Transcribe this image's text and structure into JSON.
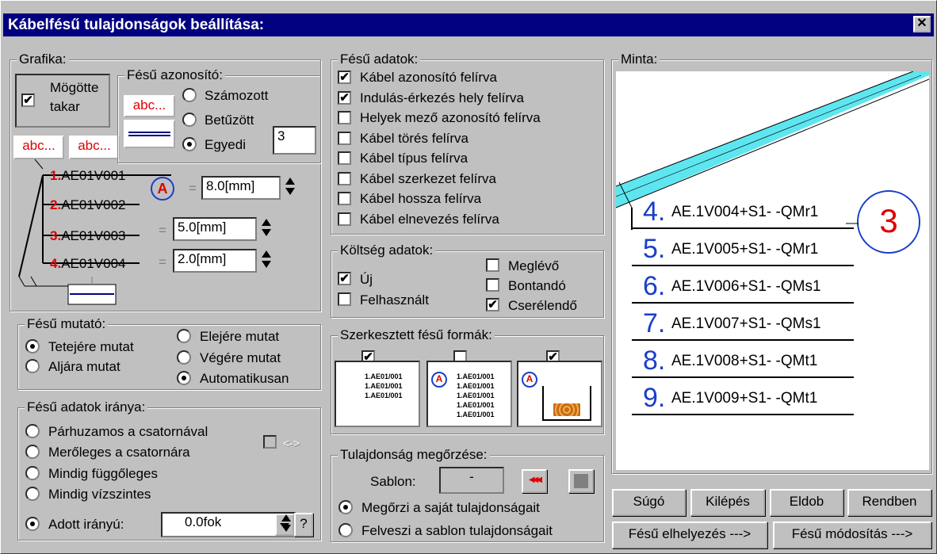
{
  "window": {
    "title": "Kábelfésű tulajdonságok beállítása:",
    "close": "✕"
  },
  "grafika": {
    "legend": "Grafika:",
    "behind_label1": "Mögötte",
    "behind_label2": "takar",
    "behind_checked": true,
    "abc1": "abc...",
    "abc2": "abc...",
    "rows": [
      {
        "num": "1.",
        "code": "AE01V001"
      },
      {
        "num": "2.",
        "code": "AE01V002"
      },
      {
        "num": "3.",
        "code": "AE01V003"
      },
      {
        "num": "4.",
        "code": "AE01V004"
      }
    ],
    "a_label": "A",
    "eq": "=",
    "dim1": "8.0[mm]",
    "dim2": "5.0[mm]",
    "dim3": "2.0[mm]"
  },
  "azonosito": {
    "legend": "Fésű azonosító:",
    "abc": "abc...",
    "opts": [
      "Számozott",
      "Betűzött",
      "Egyedi"
    ],
    "selected": 2,
    "value": "3"
  },
  "mutato": {
    "legend": "Fésű mutató:",
    "left": [
      "Tetejére mutat",
      "Aljára mutat"
    ],
    "right": [
      "Elejére mutat",
      "Végére mutat",
      "Automatikusan"
    ],
    "sel_left": 0,
    "sel_right": 2
  },
  "irany": {
    "legend": "Fésű adatok iránya:",
    "opts": [
      "Párhuzamos a csatornával",
      "Merőleges a csatornára",
      "Mindig függőleges",
      "Mindig vízszintes",
      "Adott irányú:"
    ],
    "selected": 4,
    "swap": "<->",
    "angle": "0.0fok",
    "help": "?"
  },
  "adatok": {
    "legend": "Fésű adatok:",
    "items": [
      {
        "label": "Kábel azonosító felírva",
        "checked": true
      },
      {
        "label": "Indulás-érkezés hely felírva",
        "checked": true
      },
      {
        "label": "Helyek mező azonosító felírva",
        "checked": false
      },
      {
        "label": "Kábel törés felírva",
        "checked": false
      },
      {
        "label": "Kábel típus felírva",
        "checked": false
      },
      {
        "label": "Kábel szerkezet felírva",
        "checked": false
      },
      {
        "label": "Kábel hossza felírva",
        "checked": false
      },
      {
        "label": "Kábel elnevezés felírva",
        "checked": false
      }
    ]
  },
  "koltseg": {
    "legend": "Költség adatok:",
    "left": [
      {
        "label": "Új",
        "checked": true
      },
      {
        "label": "Felhasznált",
        "checked": false
      }
    ],
    "right": [
      {
        "label": "Meglévő",
        "checked": false
      },
      {
        "label": "Bontandó",
        "checked": false
      },
      {
        "label": "Cserélendő",
        "checked": true
      }
    ]
  },
  "formak": {
    "legend": "Szerkesztett fésű formák:",
    "checks": [
      true,
      false,
      true
    ],
    "thumb_text": "1.AE01/001"
  },
  "megorzes": {
    "legend": "Tulajdonság megőrzése:",
    "sablon_label": "Sablon:",
    "sablon_value": "-",
    "rewind": "◀◀◀",
    "opts": [
      "Megőrzi a saját tulajdonságait",
      "Felveszi a sablon tulajdonságait"
    ],
    "selected": 0
  },
  "minta": {
    "legend": "Minta:",
    "badge": "3",
    "rows": [
      {
        "n": "4.",
        "t": "AE.1V004+S1- -QMr1"
      },
      {
        "n": "5.",
        "t": "AE.1V005+S1- -QMr1"
      },
      {
        "n": "6.",
        "t": "AE.1V006+S1- -QMs1"
      },
      {
        "n": "7.",
        "t": "AE.1V007+S1- -QMs1"
      },
      {
        "n": "8.",
        "t": "AE.1V008+S1- -QMt1"
      },
      {
        "n": "9.",
        "t": "AE.1V009+S1- -QMt1"
      }
    ]
  },
  "buttons": {
    "sugo": "Súgó",
    "kilepes": "Kilépés",
    "eldob": "Eldob",
    "rendben": "Rendben",
    "elhelyezes": "Fésű elhelyezés --->",
    "modositas": "Fésű módosítás --->"
  },
  "colors": {
    "title_bg": "#000080",
    "accent_blue": "#1a3fc8",
    "cable": "#5ee6f0",
    "red": "#d00000"
  }
}
